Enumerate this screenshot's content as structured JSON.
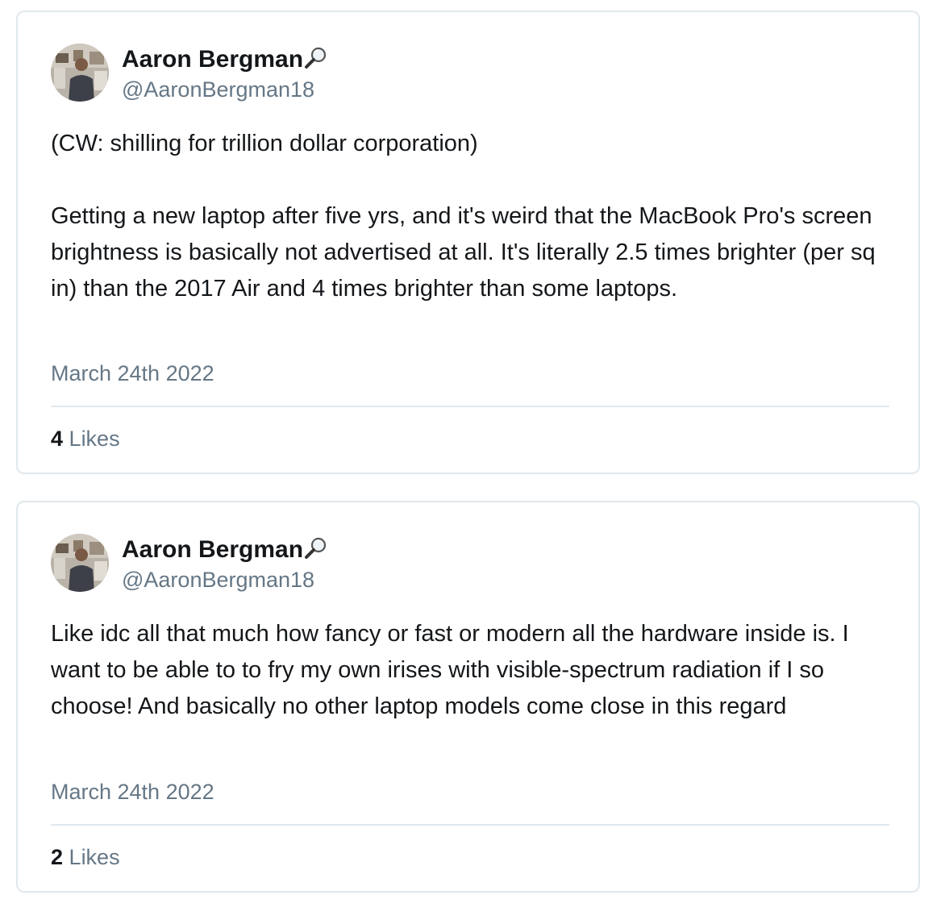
{
  "tweets": [
    {
      "author": {
        "display_name": "Aaron Bergman",
        "handle": "@AaronBergman18",
        "badge_icon": "magnifying-glass-icon",
        "avatar_icon": "avatar-photo"
      },
      "paragraphs": [
        "(CW: shilling for trillion dollar corporation)",
        "Getting a new laptop after five yrs, and it's weird that the MacBook Pro's screen brightness is basically not advertised at all. It's literally 2.5 times brighter (per sq in) than the 2017 Air and 4 times brighter than some laptops."
      ],
      "date": "March 24th 2022",
      "likes_count": "4",
      "likes_label": "Likes"
    },
    {
      "author": {
        "display_name": "Aaron Bergman",
        "handle": "@AaronBergman18",
        "badge_icon": "magnifying-glass-icon",
        "avatar_icon": "avatar-photo"
      },
      "paragraphs": [
        "Like idc all that much how fancy or fast or modern all the hardware inside is. I want to be able to to fry my own irises with visible-spectrum radiation if I so choose! And basically no other laptop models come close in this regard"
      ],
      "date": "March 24th 2022",
      "likes_count": "2",
      "likes_label": "Likes"
    }
  ],
  "colors": {
    "text_primary": "#14171a",
    "text_secondary": "#657786",
    "border": "#e1e8ed"
  }
}
